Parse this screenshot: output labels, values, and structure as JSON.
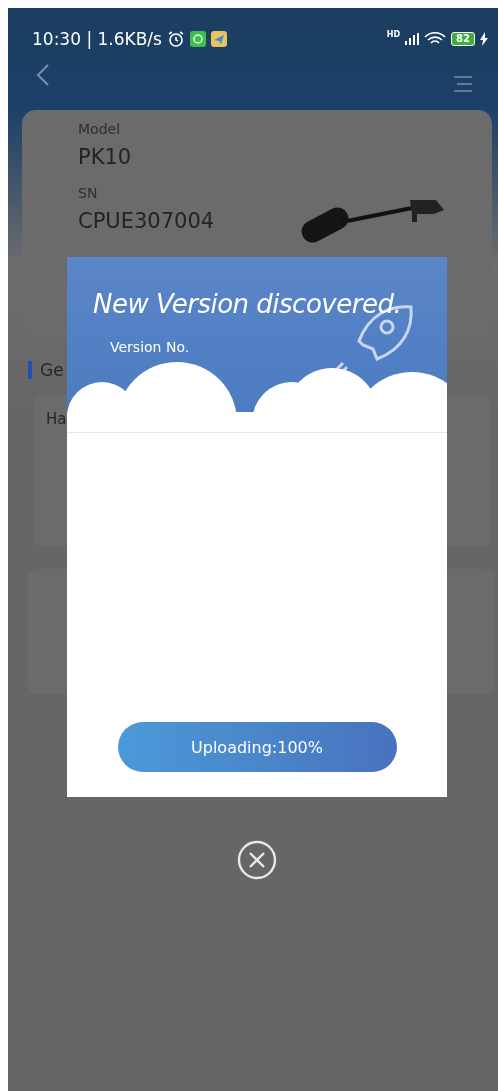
{
  "status_bar": {
    "time": "10:30 | 1.6KB/s",
    "network_badge": "HD",
    "battery": "82"
  },
  "device": {
    "model_label": "Model",
    "model": "PK10",
    "sn_label": "SN",
    "sn": "CPUE307004"
  },
  "section_title": "Ge",
  "info_card": {
    "label": "Ha"
  },
  "dialog": {
    "title": "New Version discovered.",
    "version_label": "Version No.",
    "status_button": "Uploading:100%"
  }
}
